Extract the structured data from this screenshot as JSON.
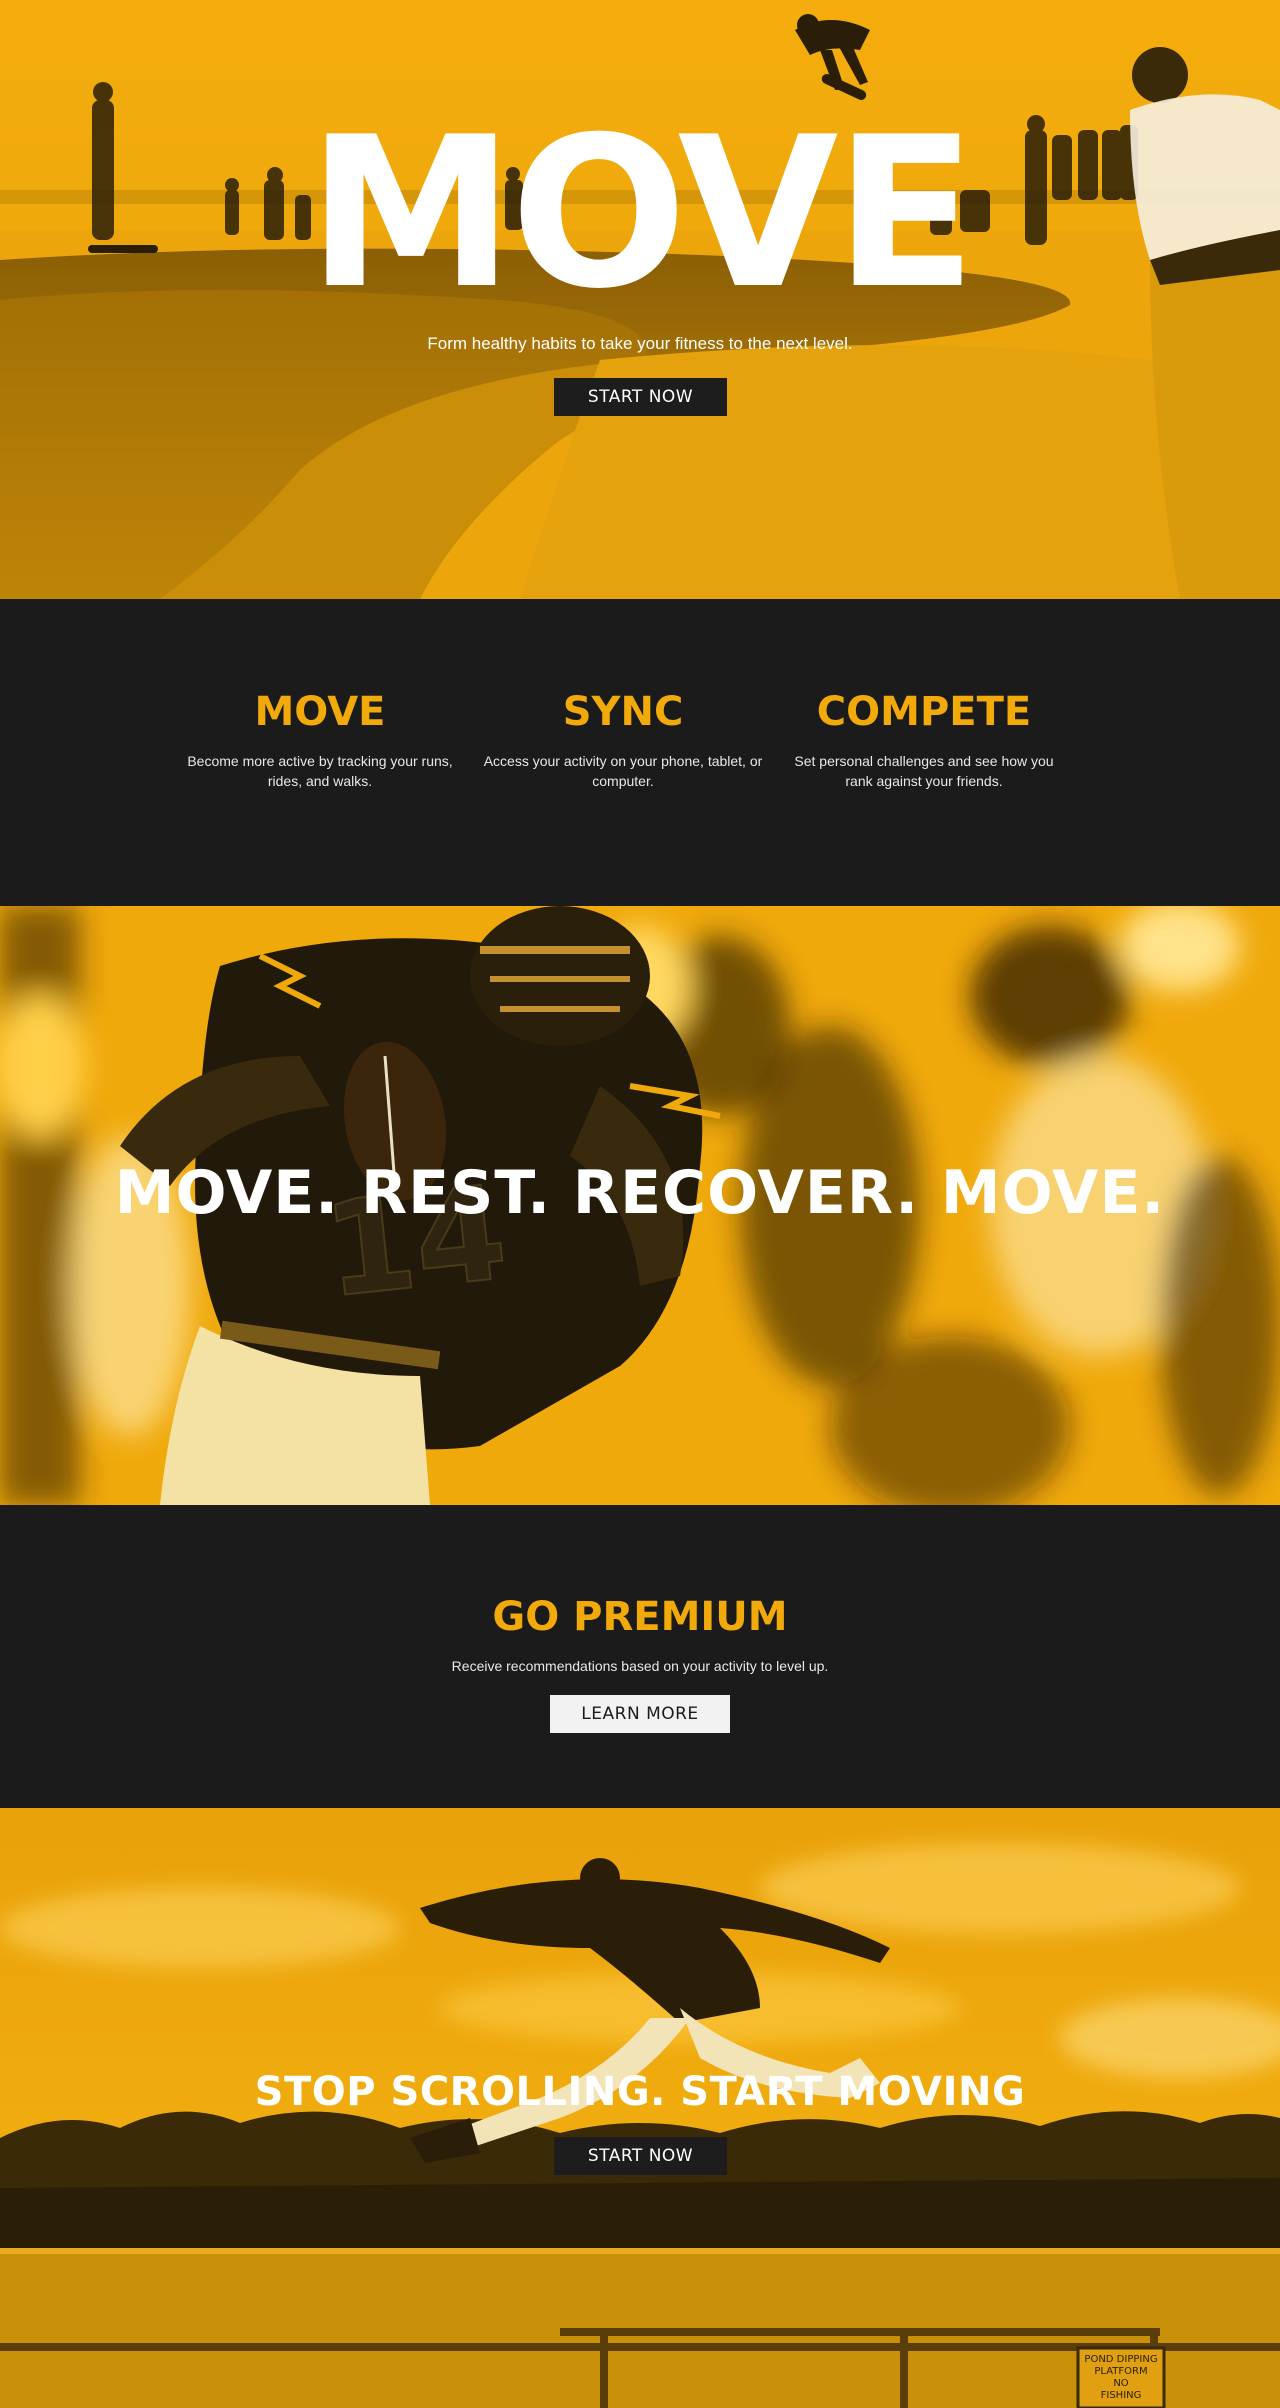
{
  "colors": {
    "accent": "#f2a90a",
    "dark": "#1b1b1b",
    "white": "#ffffff"
  },
  "hero": {
    "title": "MOVE",
    "subtitle": "Form healthy habits to take your fitness to the next level.",
    "cta_label": "START NOW"
  },
  "features": {
    "items": [
      {
        "title": "MOVE",
        "text": "Become more active by tracking your runs, rides, and walks."
      },
      {
        "title": "SYNC",
        "text": "Access your activity on your phone, tablet, or computer."
      },
      {
        "title": "COMPETE",
        "text": "Set personal challenges and see how you rank against your friends."
      }
    ]
  },
  "football": {
    "title": "MOVE. REST. RECOVER. MOVE.",
    "jersey_number": "14"
  },
  "premium": {
    "title": "GO PREMIUM",
    "text": "Receive recommendations based on your activity to level up.",
    "cta_label": "LEARN MORE"
  },
  "jump": {
    "title": "STOP SCROLLING. START MOVING",
    "cta_label": "START NOW",
    "sign_lines": [
      "POND DIPPING",
      "PLATFORM",
      "NO",
      "FISHING"
    ]
  }
}
